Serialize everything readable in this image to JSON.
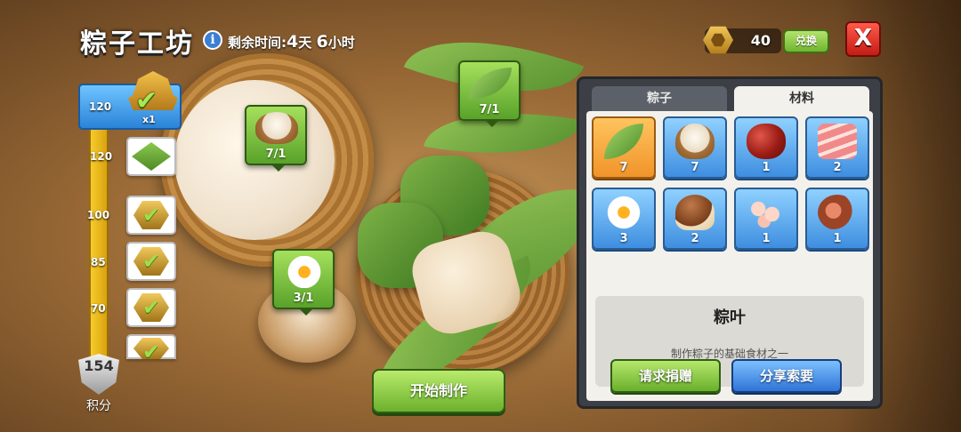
{
  "header": {
    "title": "粽子工坊",
    "time_label": "剩余时间:",
    "days_value": "4",
    "days_unit": "天",
    "hours_value": "6",
    "hours_unit": "小时"
  },
  "currency": {
    "icon": "hex-token-icon",
    "count": "40",
    "exchange_label": "兑换"
  },
  "close_label": "X",
  "progress": {
    "points": "154",
    "points_label": "积分",
    "tiers": [
      {
        "value": "120",
        "reward": "decorated-boat",
        "reward_qty": "x1",
        "claimed": true,
        "selected": true
      },
      {
        "value": "120",
        "reward": "grass-decoration",
        "claimed": false
      },
      {
        "value": "100",
        "claimed": true
      },
      {
        "value": "85",
        "claimed": true
      },
      {
        "value": "70",
        "claimed": true
      },
      {
        "value": "",
        "claimed": true
      }
    ]
  },
  "requirements": [
    {
      "item": "bamboo-leaf",
      "count": "7/1"
    },
    {
      "item": "rice-bowl",
      "count": "7/1"
    },
    {
      "item": "fried-egg",
      "count": "3/1"
    }
  ],
  "start_button_label": "开始制作",
  "panel": {
    "tabs": [
      {
        "label": "粽子",
        "active": false
      },
      {
        "label": "材料",
        "active": true
      }
    ],
    "materials": [
      {
        "item": "bamboo-leaf",
        "count": "7",
        "selected": true
      },
      {
        "item": "rice-bowl",
        "count": "7",
        "selected": false
      },
      {
        "item": "red-dates",
        "count": "1",
        "selected": false
      },
      {
        "item": "pork",
        "count": "2",
        "selected": false
      },
      {
        "item": "fried-egg",
        "count": "3",
        "selected": false
      },
      {
        "item": "chestnut",
        "count": "2",
        "selected": false
      },
      {
        "item": "sausage-slices",
        "count": "1",
        "selected": false
      },
      {
        "item": "ham",
        "count": "1",
        "selected": false
      }
    ],
    "detail": {
      "title": "粽叶",
      "description": "制作粽子的基础食材之一"
    },
    "request_donation_label": "请求捐赠",
    "share_label": "分享索要"
  }
}
